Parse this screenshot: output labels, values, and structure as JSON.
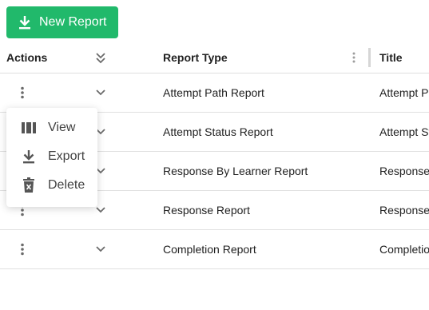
{
  "toolbar": {
    "new_report_label": "New Report",
    "new_report_icon": "download-icon",
    "accent_color": "#21b96b"
  },
  "table": {
    "columns": {
      "actions": "Actions",
      "report_type": "Report Type",
      "title": "Title"
    },
    "rows": [
      {
        "report_type": "Attempt Path Report",
        "title": "Attempt P"
      },
      {
        "report_type": "Attempt Status Report",
        "title": "Attempt St"
      },
      {
        "report_type": "Response By Learner Report",
        "title": "Response"
      },
      {
        "report_type": "Response Report",
        "title": "Response"
      },
      {
        "report_type": "Completion Report",
        "title": "Completio"
      }
    ]
  },
  "action_menu": {
    "items": [
      {
        "label": "View",
        "icon": "view-columns-icon"
      },
      {
        "label": "Export",
        "icon": "download-icon"
      },
      {
        "label": "Delete",
        "icon": "trash-icon"
      }
    ]
  }
}
